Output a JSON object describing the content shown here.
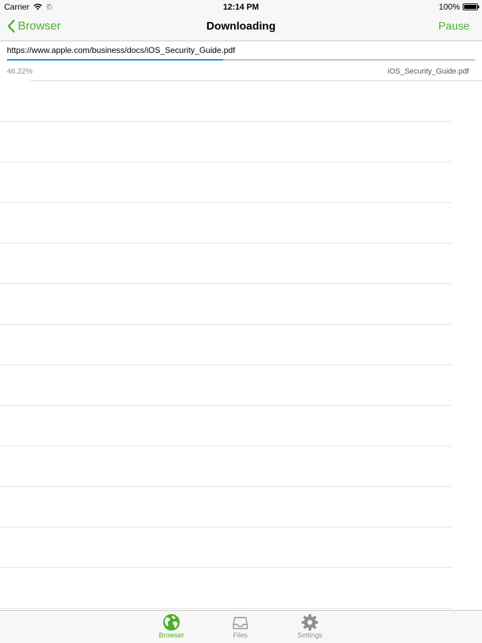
{
  "status_bar": {
    "carrier": "Carrier",
    "time": "12:14 PM",
    "battery": "100%"
  },
  "nav": {
    "back_label": "Browser",
    "title": "Downloading",
    "action_label": "Pause"
  },
  "download": {
    "url": "https://www.apple.com/business/docs/iOS_Security_Guide.pdf",
    "percent_text": "46.22%",
    "progress": 0.4622,
    "filename": "iOS_Security_Guide.pdf"
  },
  "tabs": [
    {
      "label": "Browser",
      "icon": "globe-icon",
      "active": true
    },
    {
      "label": "Files",
      "icon": "tray-icon",
      "active": false
    },
    {
      "label": "Settings",
      "icon": "gear-icon",
      "active": false
    }
  ],
  "colors": {
    "accent": "#4cb02c",
    "progress": "#1a7ef0"
  },
  "empty_row_count": 13
}
